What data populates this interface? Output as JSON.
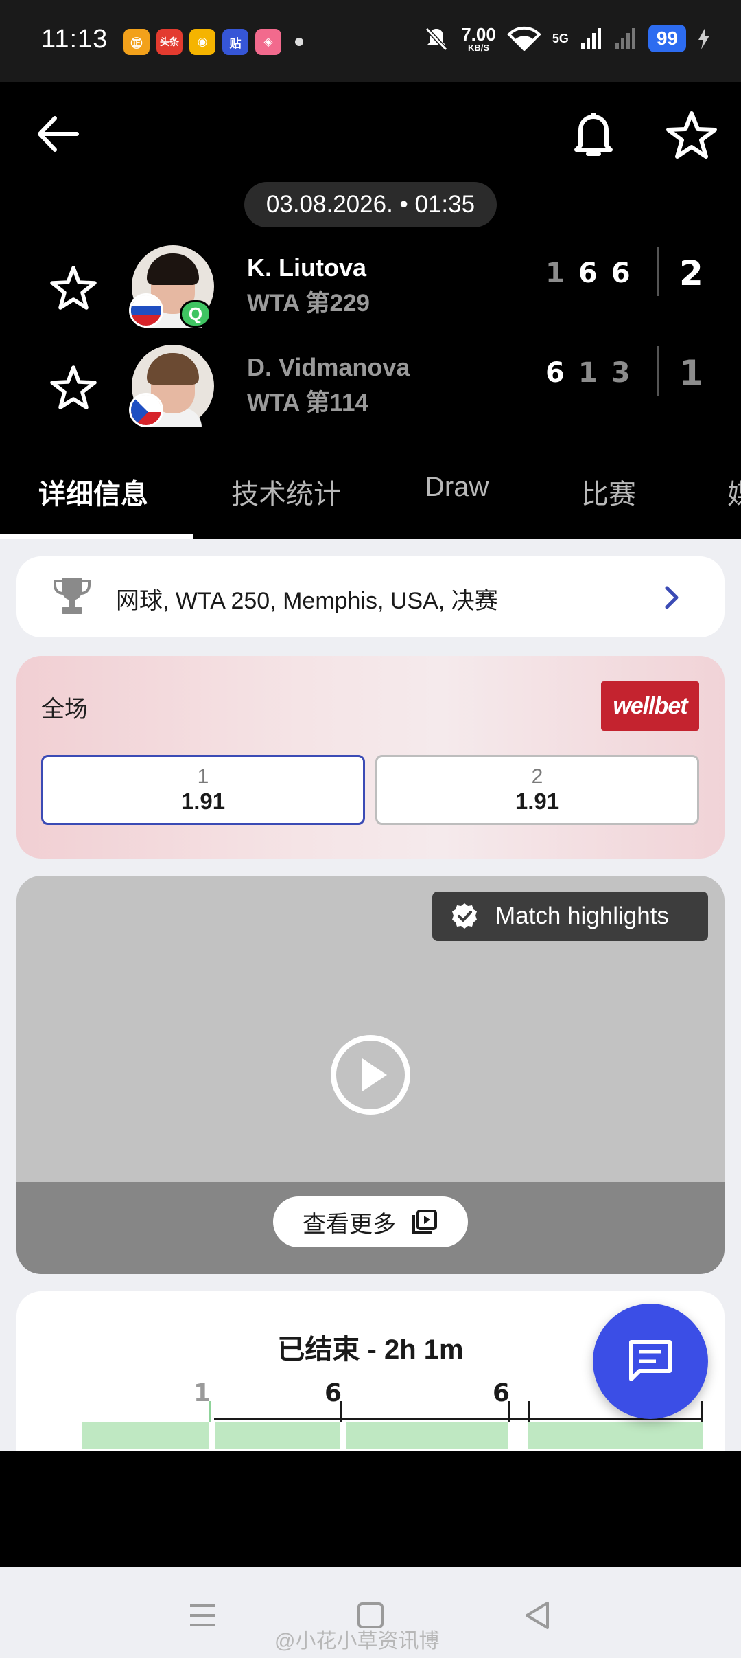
{
  "status_bar": {
    "time": "11:13",
    "apps": [
      {
        "name": "shopping-app-icon",
        "text": "㊣",
        "color": "#f2a11b"
      },
      {
        "name": "toutiao-app-icon",
        "text": "头条",
        "color": "#e33b2f"
      },
      {
        "name": "weibo-app-icon",
        "text": "◉",
        "color": "#f5b400"
      },
      {
        "name": "tieba-app-icon",
        "text": "贴",
        "color": "#3656d6"
      },
      {
        "name": "shopping-bag-app-icon",
        "text": "◈",
        "color": "#f26a8d"
      }
    ],
    "net_speed": "7.00",
    "net_unit": "KB/S",
    "network": "5G",
    "battery": "99"
  },
  "header": {
    "date": "03.08.2026. • 01:35"
  },
  "players": [
    {
      "name": "K. Liutova",
      "rank": "WTA 第229",
      "flag": "russia",
      "badge": "Q",
      "sets": [
        "1",
        "6",
        "6"
      ],
      "sets_won": [
        false,
        true,
        true
      ],
      "total": "2",
      "hair": "#1c1410"
    },
    {
      "name": "D. Vidmanova",
      "rank": "WTA 第114",
      "flag": "czech",
      "sets": [
        "6",
        "1",
        "3"
      ],
      "sets_won": [
        true,
        false,
        false
      ],
      "total": "1",
      "hair": "#6b4a32"
    }
  ],
  "tabs": [
    "详细信息",
    "技术统计",
    "Draw",
    "比赛",
    "媒"
  ],
  "tournament": {
    "text": "网球, WTA 250, Memphis, USA, 决赛"
  },
  "odds": {
    "title": "全场",
    "brand": "wellbet",
    "options": [
      {
        "label": "1",
        "value": "1.91"
      },
      {
        "label": "2",
        "value": "1.91"
      }
    ]
  },
  "video": {
    "badge": "Match highlights",
    "more": "查看更多"
  },
  "match_status": {
    "title": "已结束 - 2h 1m",
    "scale": [
      "1",
      "6",
      "6"
    ]
  },
  "nav": {
    "watermark": "@小花小草资讯博"
  },
  "colors": {
    "accent": "#3b4ee6",
    "selected_border": "#3b4bb5",
    "win_green": "#bfe8c2",
    "brand_red": "#c4232f"
  }
}
